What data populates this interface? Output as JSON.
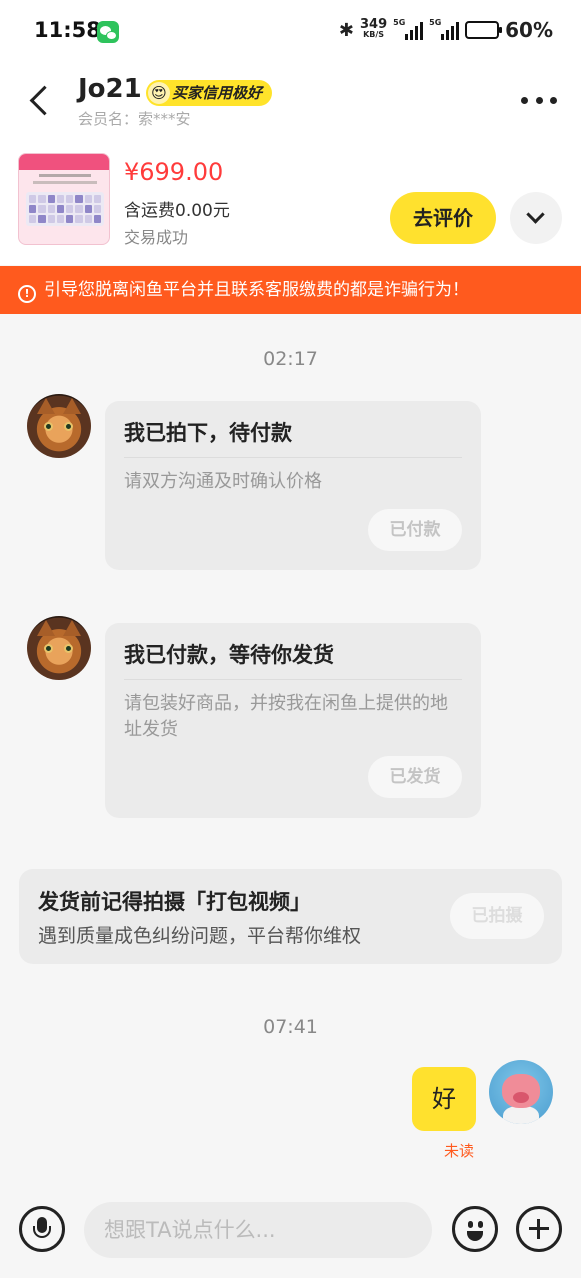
{
  "status_bar": {
    "time": "11:58",
    "network_speed": "349",
    "network_unit": "KB/S",
    "sim1": "5G",
    "sim2": "5G",
    "battery": "60%",
    "battery_level": 0.6
  },
  "header": {
    "name": "Jo21",
    "badge": "买家信用极好",
    "member_label": "会员名：索***安"
  },
  "product": {
    "price": "¥699.00",
    "shipping": "含运费0.00元",
    "status": "交易成功",
    "review_button": "去评价"
  },
  "warning": {
    "text": "引导您脱离闲鱼平台并且联系客服缴费的都是诈骗行为！"
  },
  "messages": {
    "time1": "02:17",
    "card1": {
      "title": "我已拍下，待付款",
      "desc": "请双方沟通及时确认价格",
      "button": "已付款"
    },
    "card2": {
      "title": "我已付款，等待你发货",
      "desc": "请包装好商品，并按我在闲鱼上提供的地址发货",
      "button": "已发货"
    },
    "tip": {
      "title": "发货前记得拍摄「打包视频」",
      "desc": "遇到质量成色纠纷问题，平台帮你维权",
      "button": "已拍摄"
    },
    "time2": "07:41",
    "my_message": "好",
    "read_status": "未读"
  },
  "input": {
    "placeholder": "想跟TA说点什么..."
  },
  "colors": {
    "accent_yellow": "#ffe12e",
    "warning_orange": "#ff5a1e",
    "price_red": "#ff3b3b"
  },
  "icons": [
    "back-icon",
    "more-icon",
    "expand-icon",
    "warning-icon",
    "voice-icon",
    "emoji-icon",
    "plus-icon",
    "bluetooth-icon",
    "wechat-icon",
    "battery-icon"
  ]
}
